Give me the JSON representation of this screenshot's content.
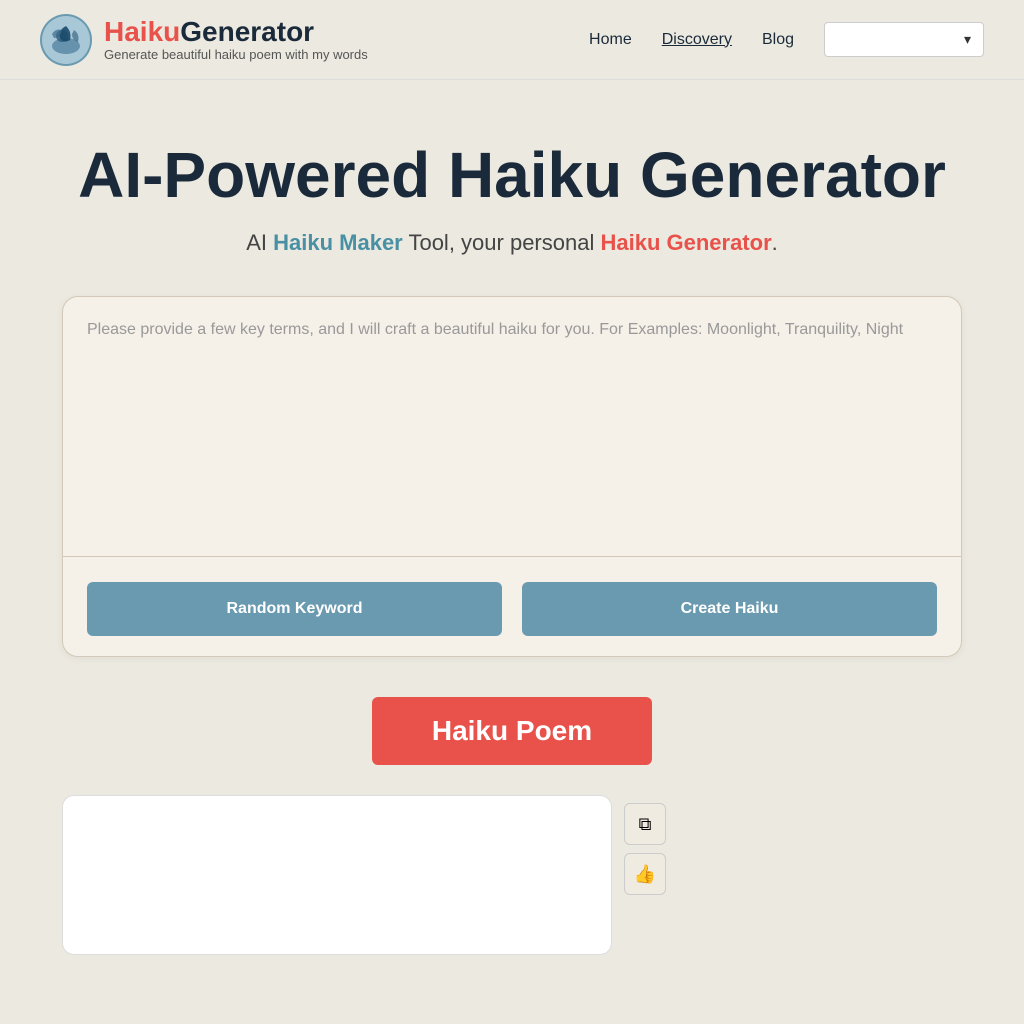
{
  "header": {
    "logo": {
      "haiku": "Haiku",
      "generator": "Generator",
      "subtitle": "Generate beautiful haiku poem with my words"
    },
    "nav": {
      "home": "Home",
      "discovery": "Discovery",
      "blog": "Blog",
      "dropdown_placeholder": ""
    }
  },
  "main": {
    "title": "AI-Powered Haiku Generator",
    "subtitle_prefix": "AI ",
    "subtitle_haiku_maker": "Haiku Maker",
    "subtitle_middle": " Tool, your personal ",
    "subtitle_haiku_generator": "Haiku Generator",
    "subtitle_suffix": ".",
    "textarea_placeholder": "Please provide a few key terms, and I will craft a beautiful haiku for you. For Examples: Moonlight, Tranquility, Night",
    "btn_random": "Random Keyword",
    "btn_create": "Create Haiku",
    "haiku_poem_badge": "Haiku Poem",
    "copy_icon": "⧉",
    "like_icon": "👍"
  }
}
